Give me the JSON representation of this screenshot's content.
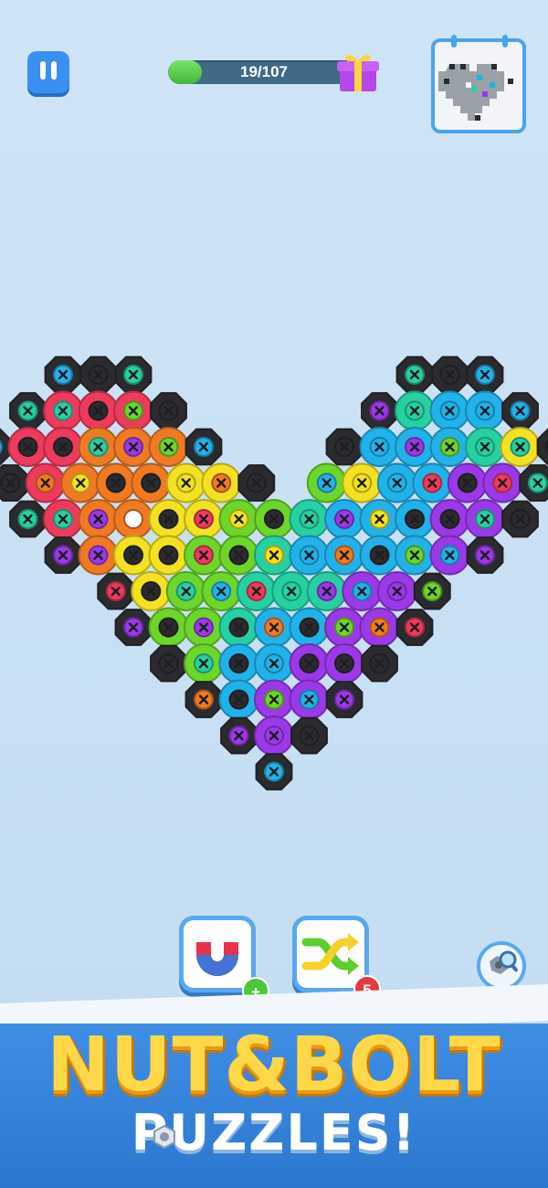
{
  "hud": {
    "progress_text": "19/107",
    "progress_value": 19,
    "progress_total": 107,
    "pause_icon": "pause-icon",
    "gift_icon": "gift-box-icon",
    "target_preview_icon": "pixel-heart-icon"
  },
  "colors": {
    "K": "#2b2b2f",
    "R": "#ee3a5c",
    "O": "#f07a22",
    "Y": "#f4e222",
    "G": "#6dd62a",
    "M": "#27d0a2",
    "C": "#22b2ea",
    "P": "#9b39e8",
    "accent": "#3b8ff0"
  },
  "board": {
    "legend": "Each string is one row of the heart; letters are nut colors, '.' is empty, '_' is an empty bolt hole, a lowercase second letter is the bolt color.",
    "rows": [
      [
        ". . Kc Kk Km . . . . . . . Km Kk Kc . ."
      ],
      [
        ". Km Rm Rk Rg Kk . . . . . Kp Mm Cc Cc Kc ."
      ],
      [
        "Kc Rk Rk Om Op Og Kc . . . Kk Cc Cp Cg Mm Ym Kk"
      ],
      [
        "Kk Ro Oy Ok Ok Yy Yo Kk . Gc Yy Cc Cr Pk Pr Km"
      ],
      [
        "Km Rm Op O_ Yk Yr Gy Gk Mm Cp Cy Ck Pk Pm Kk"
      ],
      [
        ". Kp Op Yk Yk Gr Gk My Cc Co Ck Cg Pc Kp ."
      ],
      [
        ". . Kr Yk Gm Gc Mr Mm Mp Pc Pp Kg . ."
      ],
      [
        ". . . Kp Gk Gp Mk Co Ck Pg Po Kr . . ."
      ],
      [
        ". . . . Kk Gm Ck Cc Pk Pk Kk . . . ."
      ],
      [
        ". . . . . Ko Ck Pg Pc Kp . . . . ."
      ],
      [
        ". . . . . . Kp Pp Kk . . . . . ."
      ],
      [
        ". . . . . . . Kc . . . . . . ."
      ]
    ]
  },
  "tools": {
    "magnet_icon": "magnet-icon",
    "magnet_badge_icon": "plus-icon",
    "shuffle_icon": "shuffle-icon",
    "shuffle_count": "5",
    "zoom_icon": "magnify-nut-icon"
  },
  "banner": {
    "line1": "NUT&BOLT",
    "line2": "PUZZLES!",
    "nut_icon": "nut-icon"
  }
}
